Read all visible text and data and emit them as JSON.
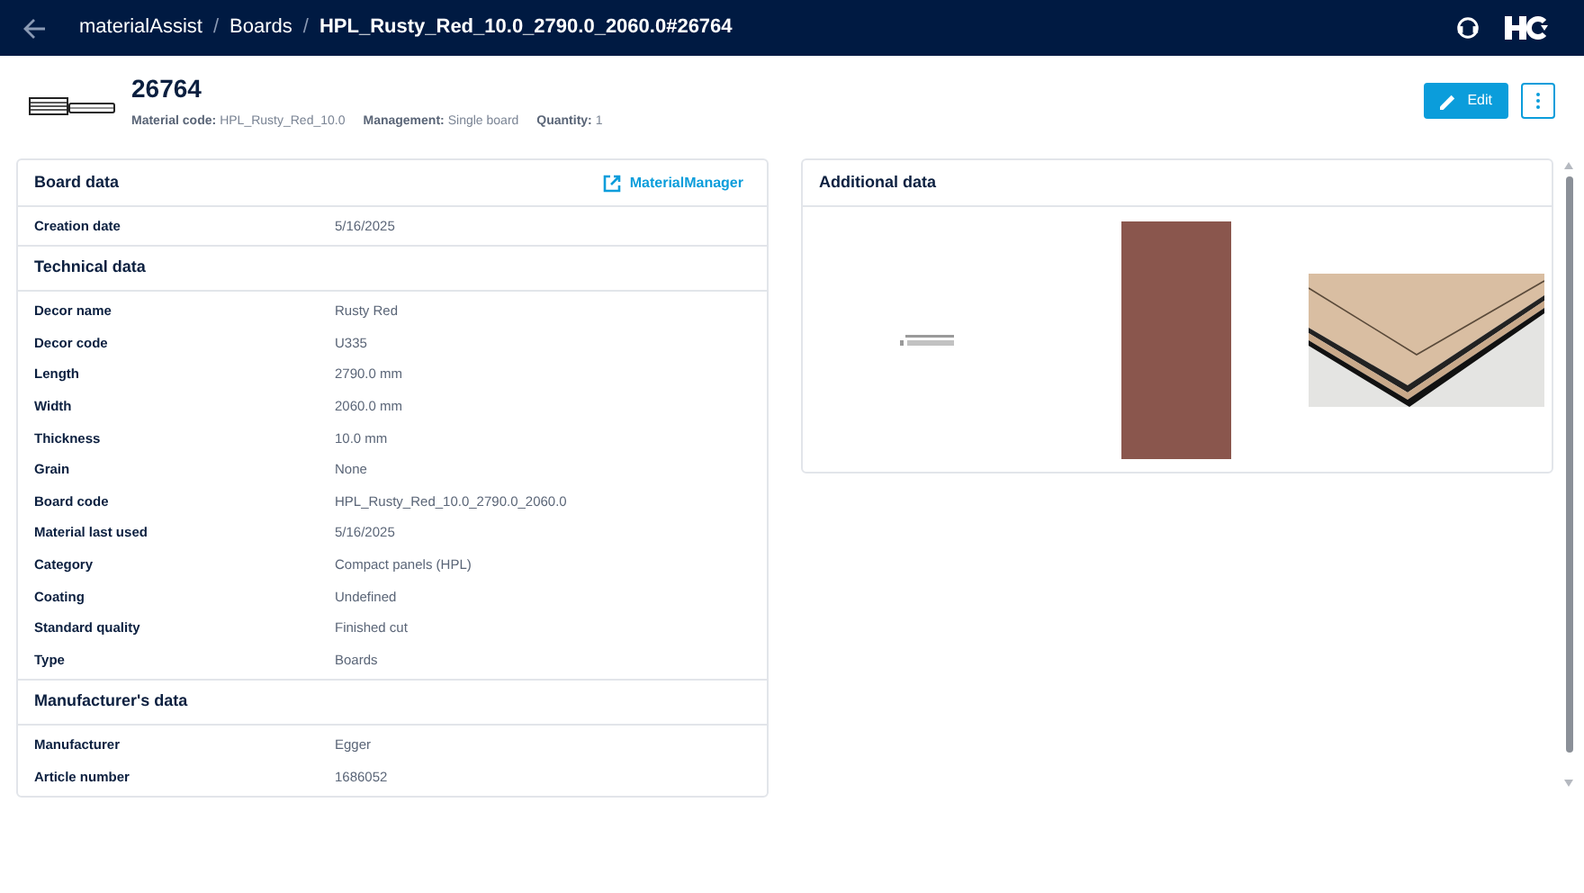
{
  "breadcrumb": [
    {
      "kind": "link",
      "label": "materialAssist"
    },
    {
      "kind": "separator",
      "label": "/"
    },
    {
      "kind": "link",
      "label": "Boards"
    },
    {
      "kind": "separator",
      "label": "/"
    },
    {
      "kind": "current",
      "label": "HPL_Rusty_Red_10.0_2790.0_2060.0#26764"
    }
  ],
  "header": {
    "title": "26764",
    "meta": [
      {
        "label": "Material code:",
        "value": "HPL_Rusty_Red_10.0"
      },
      {
        "label": "Management:",
        "value": "Single board"
      },
      {
        "label": "Quantity:",
        "value": "1"
      }
    ],
    "edit_button": "Edit"
  },
  "board_data": {
    "title": "Board data",
    "link": "MaterialManager",
    "sections": [
      {
        "rows": [
          {
            "label": "Creation date",
            "value": "5/16/2025"
          }
        ]
      },
      {
        "title": "Technical data",
        "rows": [
          {
            "label": "Decor name",
            "value": "Rusty Red"
          },
          {
            "label": "Decor code",
            "value": "U335"
          },
          {
            "label": "Length",
            "value": "2790.0 mm"
          },
          {
            "label": "Width",
            "value": "2060.0 mm"
          },
          {
            "label": "Thickness",
            "value": "10.0 mm"
          },
          {
            "label": "Grain",
            "value": "None"
          },
          {
            "label": "Board code",
            "value": "HPL_Rusty_Red_10.0_2790.0_2060.0"
          },
          {
            "label": "Material last used",
            "value": "5/16/2025"
          },
          {
            "label": "Category",
            "value": "Compact panels (HPL)"
          },
          {
            "label": "Coating",
            "value": "Undefined"
          },
          {
            "label": "Standard quality",
            "value": "Finished cut"
          },
          {
            "label": "Type",
            "value": "Boards"
          }
        ]
      },
      {
        "title": "Manufacturer's data",
        "rows": [
          {
            "label": "Manufacturer",
            "value": "Egger"
          },
          {
            "label": "Article number",
            "value": "1686052"
          }
        ]
      }
    ]
  },
  "additional_data": {
    "title": "Additional data",
    "images": [
      {
        "kind": "logo"
      },
      {
        "kind": "swatch",
        "color": "#8a564d"
      },
      {
        "kind": "picture"
      }
    ]
  }
}
